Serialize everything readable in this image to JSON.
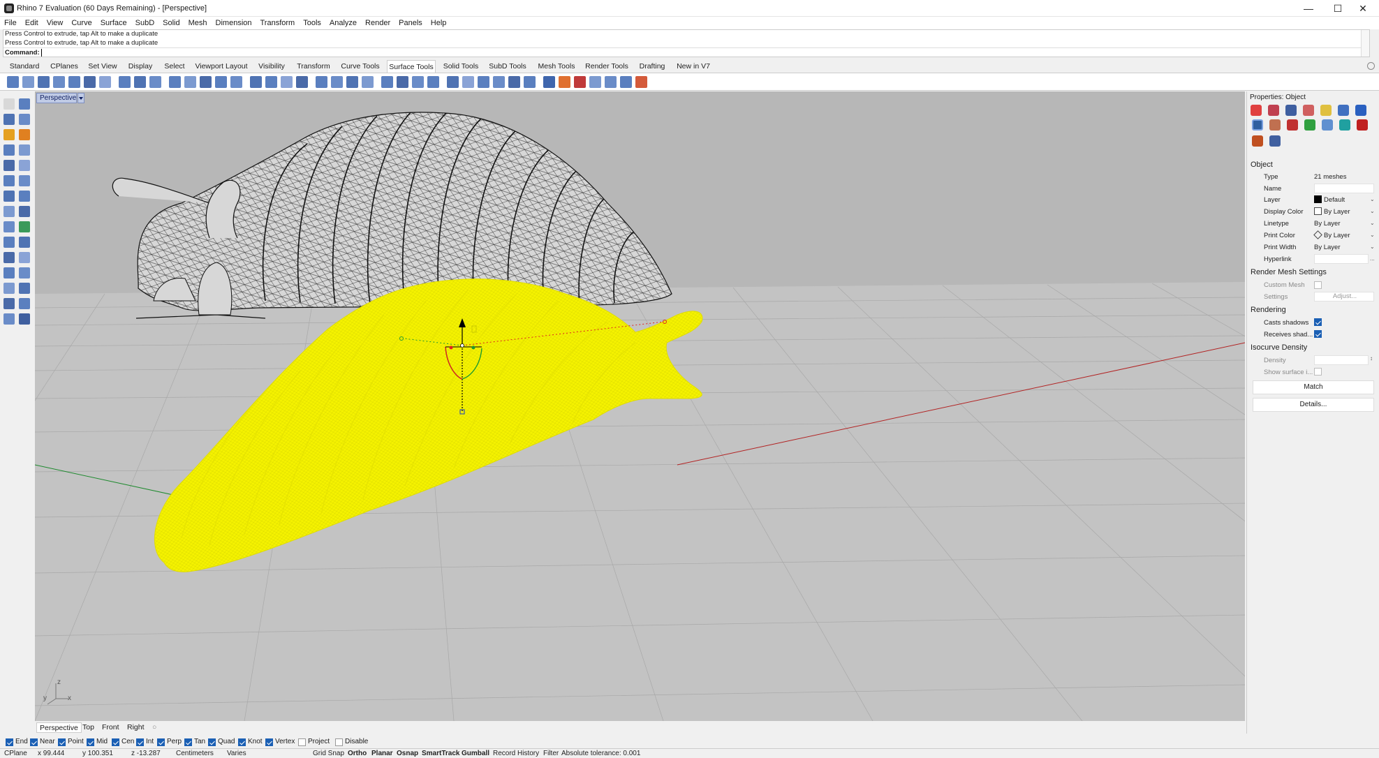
{
  "window": {
    "title": "Rhino 7 Evaluation (60 Days Remaining) - [Perspective]"
  },
  "menu": [
    "File",
    "Edit",
    "View",
    "Curve",
    "Surface",
    "SubD",
    "Solid",
    "Mesh",
    "Dimension",
    "Transform",
    "Tools",
    "Analyze",
    "Render",
    "Panels",
    "Help"
  ],
  "command": {
    "history": [
      "Press Control to extrude, tap Alt to make a duplicate",
      "Press Control to extrude, tap Alt to make a duplicate"
    ],
    "prompt": "Command:"
  },
  "toolbar_tabs": [
    "Standard",
    "CPlanes",
    "Set View",
    "Display",
    "Select",
    "Viewport Layout",
    "Visibility",
    "Transform",
    "Curve Tools",
    "Surface Tools",
    "Solid Tools",
    "SubD Tools",
    "Mesh Tools",
    "Render Tools",
    "Drafting",
    "New in V7"
  ],
  "active_tab": "Surface Tools",
  "viewport": {
    "name": "Perspective",
    "axes": {
      "z": "z",
      "y": "y",
      "x": "x"
    },
    "tabs": [
      "Perspective",
      "Top",
      "Front",
      "Right"
    ]
  },
  "properties": {
    "panel_title": "Properties: Object",
    "object_header": "Object",
    "type_label": "Type",
    "type_value": "21 meshes",
    "name_label": "Name",
    "name_value": "",
    "layer_label": "Layer",
    "layer_value": "Default",
    "display_color_label": "Display Color",
    "display_color_value": "By Layer",
    "linetype_label": "Linetype",
    "linetype_value": "By Layer",
    "print_color_label": "Print Color",
    "print_color_value": "By Layer",
    "print_width_label": "Print Width",
    "print_width_value": "By Layer",
    "hyperlink_label": "Hyperlink",
    "hyperlink_value": "...",
    "render_mesh_header": "Render Mesh Settings",
    "custom_mesh_label": "Custom Mesh",
    "settings_label": "Settings",
    "settings_button": "Adjust...",
    "rendering_header": "Rendering",
    "casts_shadows_label": "Casts shadows",
    "receives_shadows_label": "Receives shad...",
    "isocurve_header": "Isocurve Density",
    "density_label": "Density",
    "show_surface_label": "Show surface i...",
    "match_button": "Match",
    "details_button": "Details..."
  },
  "osnaps": [
    {
      "label": "End",
      "checked": true
    },
    {
      "label": "Near",
      "checked": true
    },
    {
      "label": "Point",
      "checked": true
    },
    {
      "label": "Mid",
      "checked": true
    },
    {
      "label": "Cen",
      "checked": true
    },
    {
      "label": "Int",
      "checked": true
    },
    {
      "label": "Perp",
      "checked": true
    },
    {
      "label": "Tan",
      "checked": true
    },
    {
      "label": "Quad",
      "checked": true
    },
    {
      "label": "Knot",
      "checked": true
    },
    {
      "label": "Vertex",
      "checked": true
    },
    {
      "label": "Project",
      "checked": false
    },
    {
      "label": "Disable",
      "checked": false
    }
  ],
  "status": {
    "cplane": "CPlane",
    "x": "x 99.444",
    "y": "y 100.351",
    "z": "z -13.287",
    "units": "Centimeters",
    "layer": "Varies",
    "grid_snap": "Grid Snap",
    "ortho": "Ortho",
    "planar": "Planar",
    "osnap": "Osnap",
    "smarttrack": "SmartTrack",
    "gumball": "Gumball",
    "record_history": "Record History",
    "filter": "Filter",
    "tolerance": "Absolute tolerance: 0.001"
  },
  "colors": {
    "selection": "#ffff00",
    "viewport_bg": "#b7b7b7",
    "active_viewport_tab": "#c0cbe6"
  }
}
